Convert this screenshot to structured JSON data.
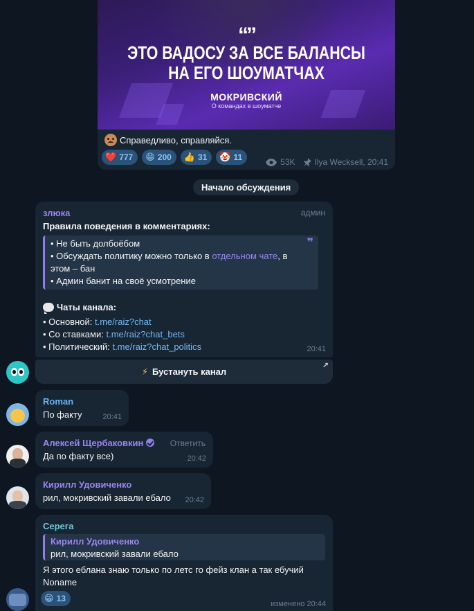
{
  "post": {
    "quote_mark": "“”",
    "headline_line1": "ЭТО ВАДОСУ ЗА ВСЕ БАЛАНСЫ",
    "headline_line2": "НА ЕГО ШОУМАТЧАХ",
    "author": "МОКРИВСКИЙ",
    "author_sub": "О командах в шоуматче",
    "caption": "Справедливо, справляйся.",
    "reactions": [
      {
        "emoji": "❤️",
        "count": "777"
      },
      {
        "emoji": "😁",
        "count": "200"
      },
      {
        "emoji": "👍",
        "count": "31"
      },
      {
        "emoji": "🤡",
        "count": "11"
      }
    ],
    "views": "53K",
    "author_sign": "Ilya Wecksell, 20:41"
  },
  "service": {
    "label": "Начало обсуждения"
  },
  "pinned": {
    "sender": "злюка",
    "badge": "админ",
    "rules_title": "Правила поведения в комментариях:",
    "rule1": "• Не быть долбоёбом",
    "rule2_prefix": "• Обсуждать политику можно только в ",
    "rule2_link": "отдельном чате",
    "rule2_suffix": ", в",
    "rule2_line2": "этом – бан",
    "rule3": "• Админ банит на своё усмотрение",
    "chats_title": "Чаты канала:",
    "chat1_label": "• Основной: ",
    "chat1_link": "t.me/raiz?chat",
    "chat2_label": "• Со ставками: ",
    "chat2_link": "t.me/raiz?chat_bets",
    "chat3_label": "• Политический: ",
    "chat3_link": "t.me/raiz?chat_politics",
    "time": "20:41"
  },
  "boost": {
    "label": "Бустануть канал"
  },
  "messages": [
    {
      "sender": "Roman",
      "text": "По факту",
      "time": "20:41"
    },
    {
      "sender": "Алексей Щербаковкин",
      "reply_label": "Ответить",
      "text": "Да по факту все)",
      "time": "20:42"
    },
    {
      "sender": "Кирилл Удовиченко",
      "text": "рил, мокривский завали ебало",
      "time": "20:42"
    },
    {
      "sender": "Серега",
      "reply_to_name": "Кирилл Удовиченко",
      "reply_to_text": "рил, мокривский завали ебало",
      "text_line1": "Я этого еблана знаю только по летс го фейз клан а так ебучий",
      "text_line2": "Noname",
      "reaction_count": "13",
      "time": "изменено 20:44"
    }
  ],
  "colors": {
    "background": "#0e1621",
    "bubble": "#182533",
    "accent_purple": "#9a86f0",
    "link": "#71baf7",
    "name_blue": "#6ab3f3",
    "name_teal": "#6fc7d9"
  }
}
